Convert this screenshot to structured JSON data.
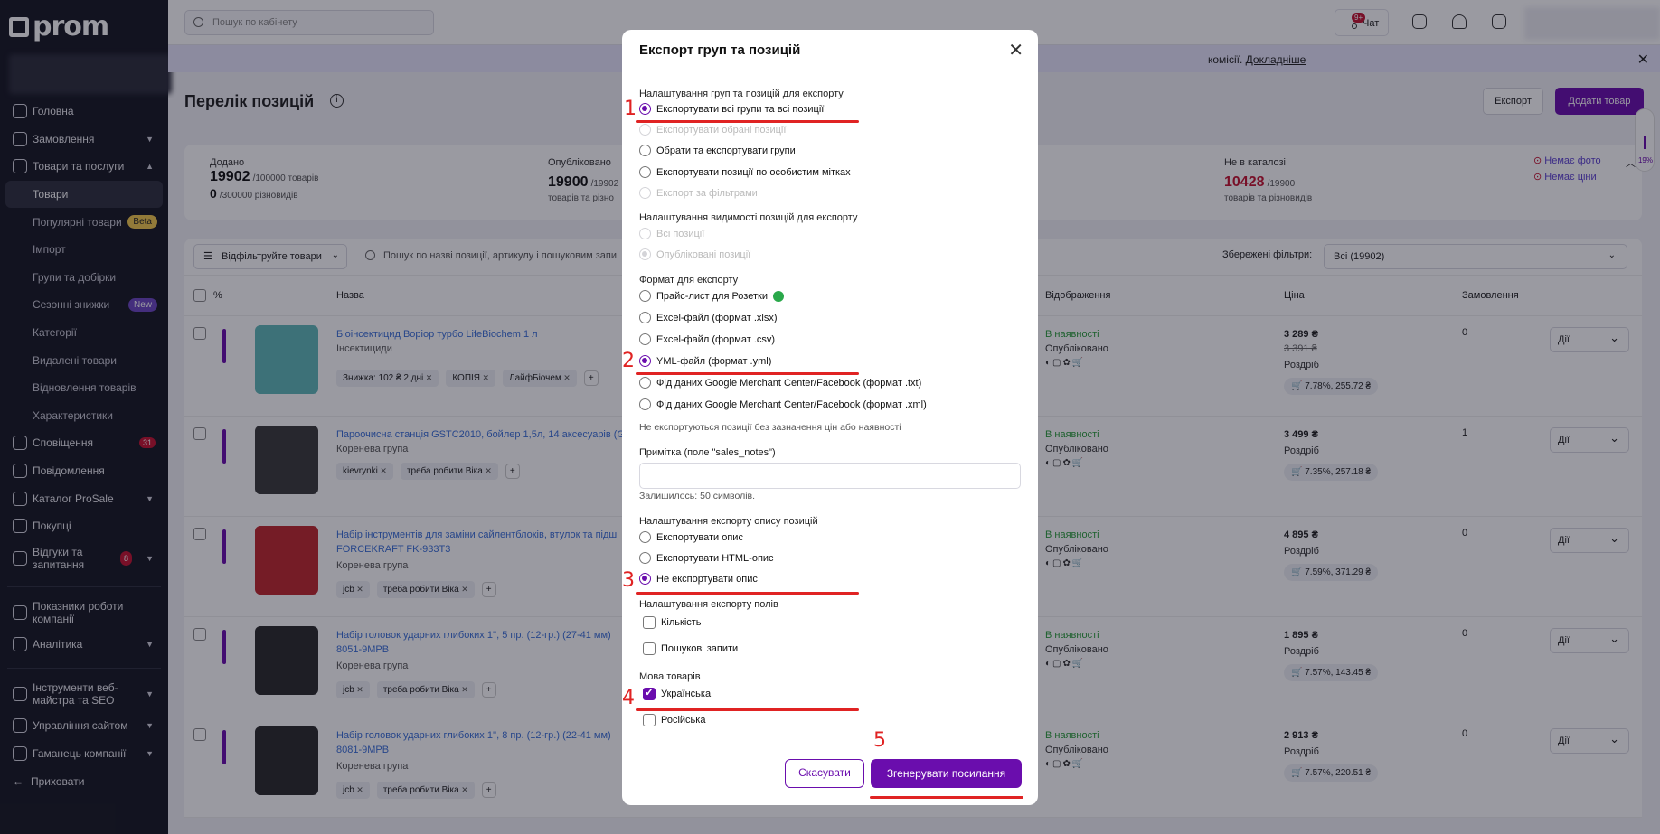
{
  "app": {
    "logo": "prom"
  },
  "sidebar": {
    "items": [
      {
        "label": "Головна"
      },
      {
        "label": "Замовлення"
      },
      {
        "label": "Товари та послуги"
      },
      {
        "label": "Товари"
      },
      {
        "label": "Популярні товари",
        "badge": "Beta"
      },
      {
        "label": "Імпорт"
      },
      {
        "label": "Групи та добірки"
      },
      {
        "label": "Сезонні знижки",
        "badge": "New"
      },
      {
        "label": "Категорії"
      },
      {
        "label": "Видалені товари"
      },
      {
        "label": "Відновлення товарів"
      },
      {
        "label": "Характеристики"
      },
      {
        "label": "Сповіщення",
        "badge": "31"
      },
      {
        "label": "Повідомлення"
      },
      {
        "label": "Каталог ProSale"
      },
      {
        "label": "Покупці"
      },
      {
        "label": "Відгуки та запитання",
        "badge": "8"
      },
      {
        "label": "Показники роботи компанії"
      },
      {
        "label": "Аналітика"
      },
      {
        "label": "Інструменти веб-майстра та SEO"
      },
      {
        "label": "Управління сайтом"
      },
      {
        "label": "Гаманець компанії"
      },
      {
        "label": "Приховати"
      }
    ]
  },
  "topbar": {
    "search_placeholder": "Пошук по кабінету",
    "chat_label": "Чат",
    "chat_badge": "9+"
  },
  "banner": {
    "text": "комісії.",
    "link": "Докладніше"
  },
  "page": {
    "title": "Перелік позицій",
    "export_btn": "Експорт",
    "add_btn": "Додати товар"
  },
  "stats": {
    "added_label": "Додано",
    "added_count": "19902",
    "added_limit": "/100000 товарів",
    "added_variants": "0",
    "added_variants_limit": "/300000 різновидів",
    "published_label": "Опубліковано",
    "published_count": "19900",
    "published_limit": "/19902",
    "published_sub": "товарів та різно",
    "notcat_label": "Не в каталозі",
    "notcat_count": "10428",
    "notcat_limit": "/19900",
    "notcat_sub": "товарів та різновидів",
    "no_photo": "Немає фото",
    "no_price": "Немає ціни",
    "progress_pct": "19%"
  },
  "filters": {
    "filter_btn": "Відфільтруйте товари",
    "search_placeholder": "Пошук по назві позиції, артикулу і пошуковим запи",
    "saved_label": "Збережені фільтри:",
    "saved_value": "Всі (19902)"
  },
  "table": {
    "headers": {
      "pct": "%",
      "name": "Назва",
      "display": "Відображення",
      "price": "Ціна",
      "orders": "Замовлення"
    },
    "rows": [
      {
        "name": "Біоінсектицид Воріор турбо LifeBiochem 1 л",
        "group": "Інсектициди",
        "chips": [
          "Знижка: 102 ₴ 2 дні",
          "КОПІЯ",
          "ЛайфБіочем"
        ],
        "avail": "В наявності",
        "status": "Опубліковано",
        "price": "3 289 ₴",
        "old_price": "3 391 ₴",
        "retail": "Роздріб",
        "commission": "7.78%, 255.72 ₴",
        "orders": "0",
        "action": "Дії"
      },
      {
        "name": "Пароочисна станція GSTC2010, бойлер 1,5л, 14 аксесуарів (G",
        "group": "Коренева група",
        "chips": [
          "kievrynki",
          "треба робити Віка"
        ],
        "avail": "В наявності",
        "status": "Опубліковано",
        "price": "3 499 ₴",
        "old_price": "",
        "retail": "Роздріб",
        "commission": "7.35%, 257.18 ₴",
        "orders": "1",
        "action": "Дії"
      },
      {
        "name": "Набір інструментів для заміни сайлентблоків, втулок та підш FORCEKRAFT FK-933T3",
        "group": "Коренева група",
        "chips": [
          "jcb",
          "треба робити Віка"
        ],
        "avail": "В наявності",
        "status": "Опубліковано",
        "price": "4 895 ₴",
        "old_price": "",
        "retail": "Роздріб",
        "commission": "7.59%, 371.29 ₴",
        "orders": "0",
        "action": "Дії"
      },
      {
        "name": "Набір головок ударних глибоких 1'', 5 пр. (12-гр.) (27-41 мм) 8051-9MPB",
        "group": "Коренева група",
        "chips": [
          "jcb",
          "треба робити Віка"
        ],
        "avail": "В наявності",
        "status": "Опубліковано",
        "price": "1 895 ₴",
        "old_price": "",
        "retail": "Роздріб",
        "commission": "7.57%, 143.45 ₴",
        "orders": "0",
        "action": "Дії"
      },
      {
        "name": "Набір головок ударних глибоких 1'', 8 пр. (12-гр.) (22-41 мм) 8081-9MPB",
        "group": "Коренева група",
        "chips": [
          "jcb",
          "треба робити Віка"
        ],
        "avail": "В наявності",
        "status": "Опубліковано",
        "price": "2 913 ₴",
        "old_price": "",
        "retail": "Роздріб",
        "commission": "7.57%, 220.51 ₴",
        "orders": "0",
        "action": "Дії"
      }
    ]
  },
  "modal": {
    "title": "Експорт груп та позицій",
    "sec1": "Налаштування груп та позицій для експорту",
    "o1": "Експортувати всі групи та всі позиції",
    "o2": "Експортувати обрані позиції",
    "o3": "Обрати та експортувати групи",
    "o4": "Експортувати позиції по особистим мітках",
    "o5": "Експорт за фільтрами",
    "sec2": "Налаштування видимості позицій для експорту",
    "v1": "Всі позиції",
    "v2": "Опубліковані позиції",
    "sec3": "Формат для експорту",
    "f1": "Прайс-лист для Розетки",
    "f2": "Excel-файл (формат .xlsx)",
    "f3": "Excel-файл (формат .csv)",
    "f4": "YML-файл (формат .yml)",
    "f5": "Фід даних Google Merchant Center/Facebook (формат .txt)",
    "f6": "Фід даних Google Merchant Center/Facebook (формат .xml)",
    "f_note": "Не експортуються позиції без зазначення цін або наявності",
    "notes_label": "Примітка (поле \"sales_notes\")",
    "notes_left": "Залишилось: 50 символів.",
    "sec4": "Налаштування експорту опису позицій",
    "d1": "Експортувати опис",
    "d2": "Експортувати HTML-опис",
    "d3": "Не експортувати опис",
    "sec5": "Налаштування експорту полів",
    "c1": "Кількість",
    "c2": "Пошукові запити",
    "sec6": "Мова товарів",
    "l1": "Українська",
    "l2": "Російська",
    "cancel": "Скасувати",
    "generate": "Згенерувати посилання"
  },
  "annotations": {
    "n1": "1",
    "n2": "2",
    "n3": "3",
    "n4": "4",
    "n5": "5",
    "color": "#e02323"
  },
  "colors": {
    "accent": "#6a0dad",
    "sidebar": "#161722",
    "link": "#3a6fd8",
    "available": "#2a9d3a"
  }
}
